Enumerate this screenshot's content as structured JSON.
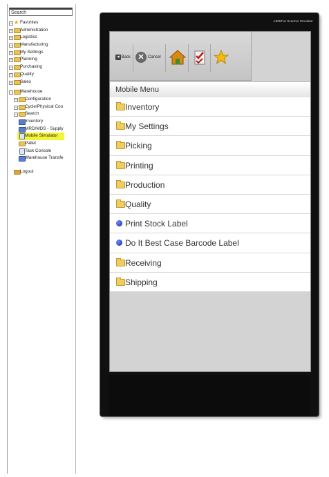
{
  "sidebar": {
    "search_value": "Search",
    "items": [
      {
        "label": "Favorites"
      },
      {
        "label": "Administration"
      },
      {
        "label": "Logistics"
      },
      {
        "label": "Manufacturing"
      },
      {
        "label": "My Settings"
      },
      {
        "label": "Planning"
      },
      {
        "label": "Purchasing"
      },
      {
        "label": "Quality"
      },
      {
        "label": "Sales"
      },
      {
        "label": "Warehouse"
      },
      {
        "label": "Configuration"
      },
      {
        "label": "Cycle/Physical Cou"
      },
      {
        "label": "Search"
      },
      {
        "label": "Inventory"
      },
      {
        "label": "MRD/MDS - Supply"
      },
      {
        "label": "Mobile Simulator"
      },
      {
        "label": "Pallet"
      },
      {
        "label": "Task Console"
      },
      {
        "label": "Warehouse Transfe"
      },
      {
        "label": "Logout"
      }
    ]
  },
  "emulator": {
    "title": "A505Tux Scanner Emulator",
    "toolbar": {
      "back_label": "Back",
      "cancel_label": "Cancel"
    },
    "menu_title": "Mobile Menu",
    "menu_items": [
      {
        "label": "Inventory",
        "icon": "folder-icon"
      },
      {
        "label": "My Settings",
        "icon": "folder-icon"
      },
      {
        "label": "Picking",
        "icon": "folder-icon"
      },
      {
        "label": "Printing",
        "icon": "folder-icon"
      },
      {
        "label": "Production",
        "icon": "folder-icon"
      },
      {
        "label": "Quality",
        "icon": "folder-icon"
      },
      {
        "label": "Print Stock Label",
        "icon": "blue-dot-icon"
      },
      {
        "label": "Do It Best Case Barcode Label",
        "icon": "blue-dot-icon"
      },
      {
        "label": "Receiving",
        "icon": "folder-icon"
      },
      {
        "label": "Shipping",
        "icon": "folder-icon"
      }
    ]
  },
  "colors": {
    "highlight": "#f4f43a",
    "emulator_frame": "#101010",
    "menu_background": "#d3d3d3",
    "bullet_blue": "#0a24a8",
    "folder_yellow": "#f0cd62"
  }
}
